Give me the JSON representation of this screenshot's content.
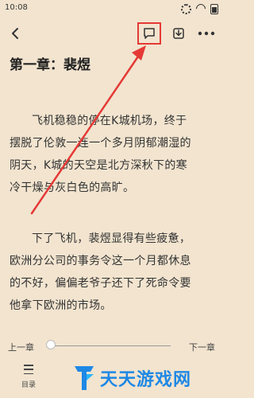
{
  "status": {
    "time": "10:08"
  },
  "toolbar": {
    "back_icon": "chevron-left-icon",
    "comment_icon": "comment-icon",
    "download_icon": "download-icon",
    "more_icon": "more-icon"
  },
  "chapter": {
    "title": "第一章：裴煜"
  },
  "paragraphs": [
    {
      "lines": [
        "飞机稳稳的停在K城机场，终于",
        "摆脱了伦敦一连一个多月阴郁潮湿的",
        "阴天，K城的天空是北方深秋下的寒",
        "冷干燥与灰白色的高旷。"
      ]
    },
    {
      "lines": [
        "下了飞机，裴煜显得有些疲惫，",
        "欧洲分公司的事务令这一个月都休息",
        "的不好，偏偏老爷子还下了死命令要",
        "他拿下欧洲的市场。"
      ]
    }
  ],
  "progress": {
    "prev_label": "上一章",
    "next_label": "下一章",
    "value": 0.0
  },
  "bottom": {
    "toc_label": "目录"
  },
  "watermark": {
    "text": "天天游戏网"
  },
  "colors": {
    "background": "#f2e4cf",
    "highlight": "#e53935",
    "brand": "#1e88e5"
  }
}
